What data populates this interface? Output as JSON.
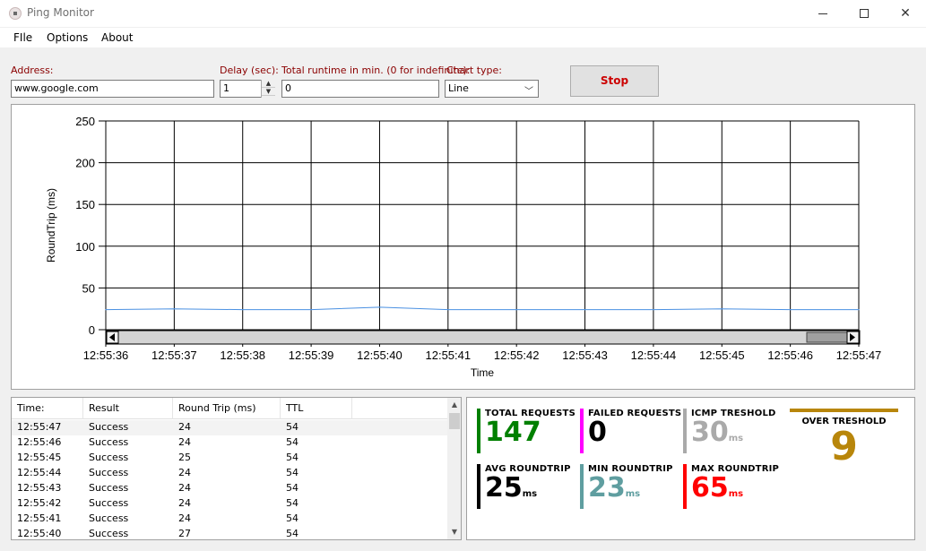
{
  "window": {
    "title": "Ping Monitor"
  },
  "menu": [
    "FIle",
    "Options",
    "About"
  ],
  "controls": {
    "address_label": "Address:",
    "address_value": "www.google.com",
    "delay_label": "Delay (sec):",
    "delay_value": "1",
    "runtime_label": "Total runtime in min. (0 for indefinite):",
    "runtime_value": "0",
    "charttype_label": "Chart type:",
    "charttype_value": "Line",
    "stop_label": "Stop"
  },
  "chart_data": {
    "type": "line",
    "xlabel": "Time",
    "ylabel": "RoundTrip (ms)",
    "ylim": [
      0,
      250
    ],
    "yticks": [
      0,
      50,
      100,
      150,
      200,
      250
    ],
    "x": [
      "12:55:36",
      "12:55:37",
      "12:55:38",
      "12:55:39",
      "12:55:40",
      "12:55:41",
      "12:55:42",
      "12:55:43",
      "12:55:44",
      "12:55:45",
      "12:55:46",
      "12:55:47"
    ],
    "series": [
      {
        "values": [
          24,
          25,
          24,
          24,
          27,
          24,
          24,
          24,
          24,
          25,
          24,
          24
        ],
        "color": "#4a90e2"
      }
    ],
    "grid": true
  },
  "log": {
    "columns": [
      "Time:",
      "Result",
      "Round Trip (ms)",
      "TTL"
    ],
    "rows": [
      [
        "12:55:47",
        "Success",
        "24",
        "54"
      ],
      [
        "12:55:46",
        "Success",
        "24",
        "54"
      ],
      [
        "12:55:45",
        "Success",
        "25",
        "54"
      ],
      [
        "12:55:44",
        "Success",
        "24",
        "54"
      ],
      [
        "12:55:43",
        "Success",
        "24",
        "54"
      ],
      [
        "12:55:42",
        "Success",
        "24",
        "54"
      ],
      [
        "12:55:41",
        "Success",
        "24",
        "54"
      ],
      [
        "12:55:40",
        "Success",
        "27",
        "54"
      ]
    ]
  },
  "stats": {
    "total": {
      "label": "TOTAL REQUESTS",
      "value": "147",
      "unit": "",
      "color": "#008000"
    },
    "failed": {
      "label": "FAILED REQUESTS",
      "value": "0",
      "unit": "",
      "color": "#ff00ff"
    },
    "icmp": {
      "label": "ICMP TRESHOLD",
      "value": "30",
      "unit": "ms",
      "color": "#aaaaaa"
    },
    "avg": {
      "label": "AVG ROUNDTRIP",
      "value": "25",
      "unit": "ms",
      "color": "#000000"
    },
    "min": {
      "label": "MIN ROUNDTRIP",
      "value": "23",
      "unit": "ms",
      "color": "#5f9ea0"
    },
    "max": {
      "label": "MAX ROUNDTRIP",
      "value": "65",
      "unit": "ms",
      "color": "#ff0000"
    },
    "over": {
      "label": "OVER TRESHOLD",
      "value": "9",
      "color": "#b8860b"
    }
  }
}
